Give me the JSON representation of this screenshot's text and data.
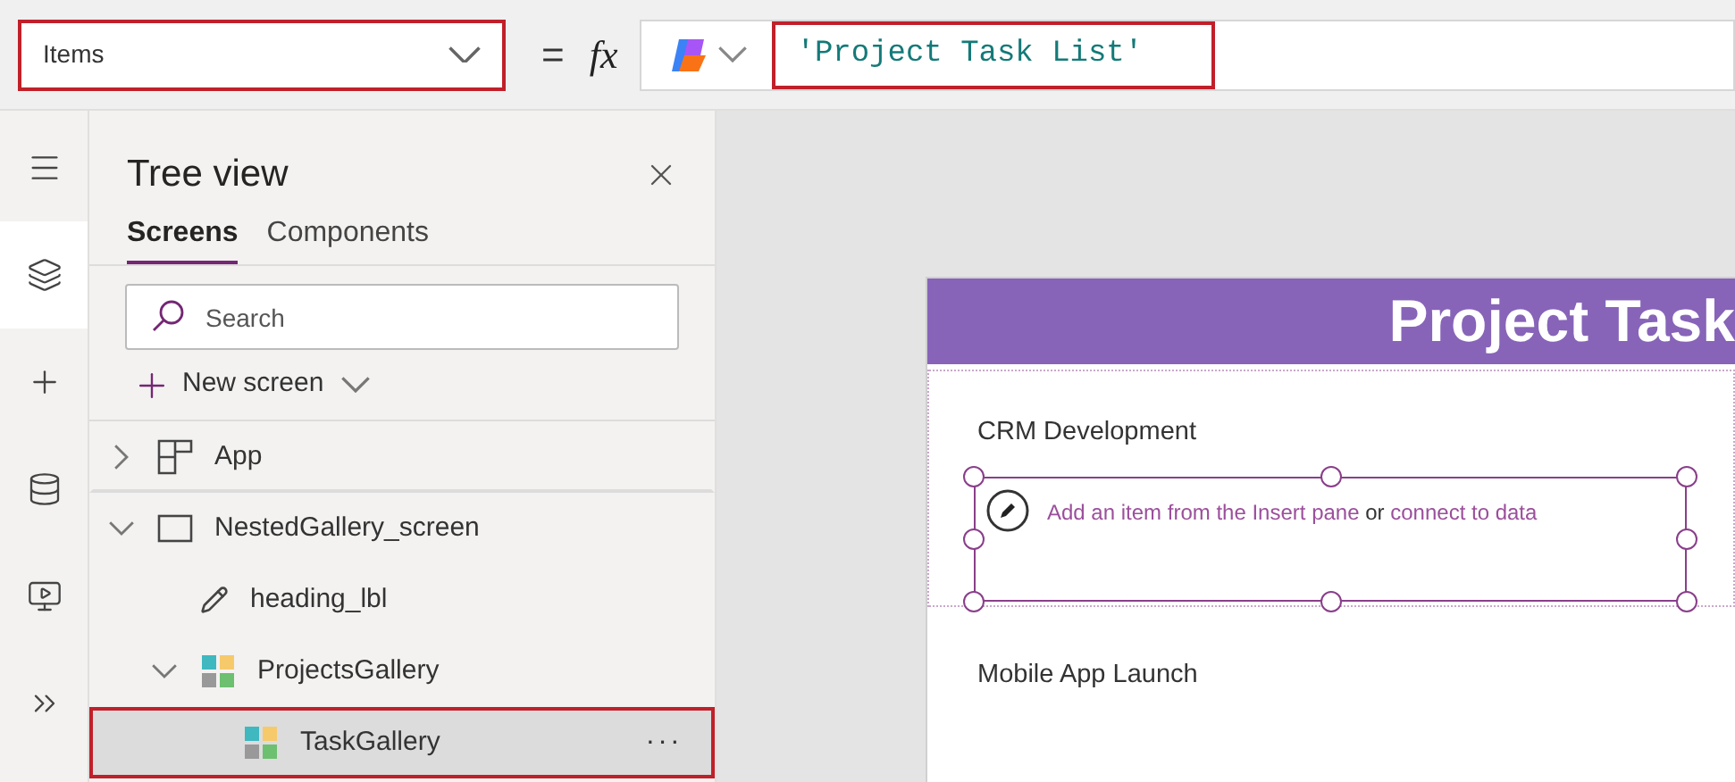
{
  "formula_bar": {
    "property": "Items",
    "property_highlighted": true,
    "equals": "=",
    "fx": "fx",
    "formula": "'Project Task List'",
    "formula_highlighted": true
  },
  "rail": [
    {
      "kind": "menu",
      "selected": false
    },
    {
      "kind": "layers",
      "selected": true
    },
    {
      "kind": "plus",
      "selected": false
    },
    {
      "kind": "data",
      "selected": false
    },
    {
      "kind": "media",
      "selected": false
    },
    {
      "kind": "flows",
      "selected": false
    }
  ],
  "tree_view": {
    "title": "Tree view",
    "tabs": [
      {
        "label": "Screens",
        "selected": true
      },
      {
        "label": "Components",
        "selected": false
      }
    ],
    "search": {
      "placeholder": "Search"
    },
    "new_screen": "New screen",
    "items": [
      {
        "label": "App",
        "kind": "app",
        "expanded": false,
        "selected": false,
        "highlighted": false
      },
      {
        "label": "NestedGallery_screen",
        "kind": "screen",
        "expanded": true,
        "selected": false,
        "highlighted": false,
        "children": [
          {
            "label": "heading_lbl",
            "kind": "label",
            "selected": false,
            "highlighted": false
          },
          {
            "label": "ProjectsGallery",
            "kind": "gallery",
            "expanded": true,
            "selected": false,
            "highlighted": false,
            "children": [
              {
                "label": "TaskGallery",
                "kind": "gallery",
                "selected": true,
                "highlighted": true,
                "more": "···"
              }
            ]
          }
        ]
      }
    ]
  },
  "canvas": {
    "header": "Project Task",
    "rows": [
      {
        "title": "CRM Development",
        "selected": true,
        "placeholder": [
          {
            "kind": "link",
            "text": "Add an item from the Insert pane"
          },
          {
            "kind": "text",
            "text": "or"
          },
          {
            "kind": "link",
            "text": "connect to data"
          }
        ]
      },
      {
        "title": "Mobile App Launch",
        "selected": false
      }
    ]
  }
}
